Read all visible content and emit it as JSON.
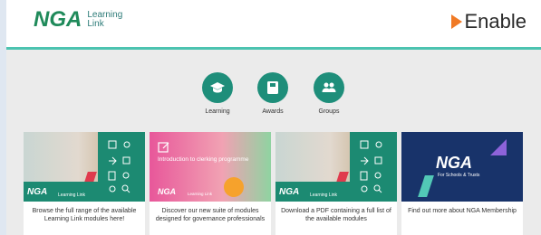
{
  "header": {
    "logo_mark": "NGA",
    "logo_text_line1": "Learning",
    "logo_text_line2": "Link",
    "enable_text": "Enable"
  },
  "nav": [
    {
      "label": "Learning",
      "icon": "graduation-cap-icon"
    },
    {
      "label": "Awards",
      "icon": "book-icon"
    },
    {
      "label": "Groups",
      "icon": "people-icon"
    }
  ],
  "cards": [
    {
      "text": "Browse the full range of the available Learning Link modules here!",
      "badge": "NGA",
      "badge_sub": "Learning Link"
    },
    {
      "text": "Discover our new suite of modules designed for governance professionals",
      "title": "Introduction to clerking programme",
      "badge": "NGA",
      "badge_sub": "Learning Link"
    },
    {
      "text": "Download a PDF containing a full list of the available modules",
      "badge": "NGA",
      "badge_sub": "Learning Link"
    },
    {
      "text": "Find out more about NGA Membership",
      "badge": "NGA",
      "badge_sub": "For Schools & Trusts"
    }
  ],
  "colors": {
    "teal": "#1e8e7a",
    "accent_rule": "#4cc3b0",
    "enable_orange": "#f07a25"
  }
}
